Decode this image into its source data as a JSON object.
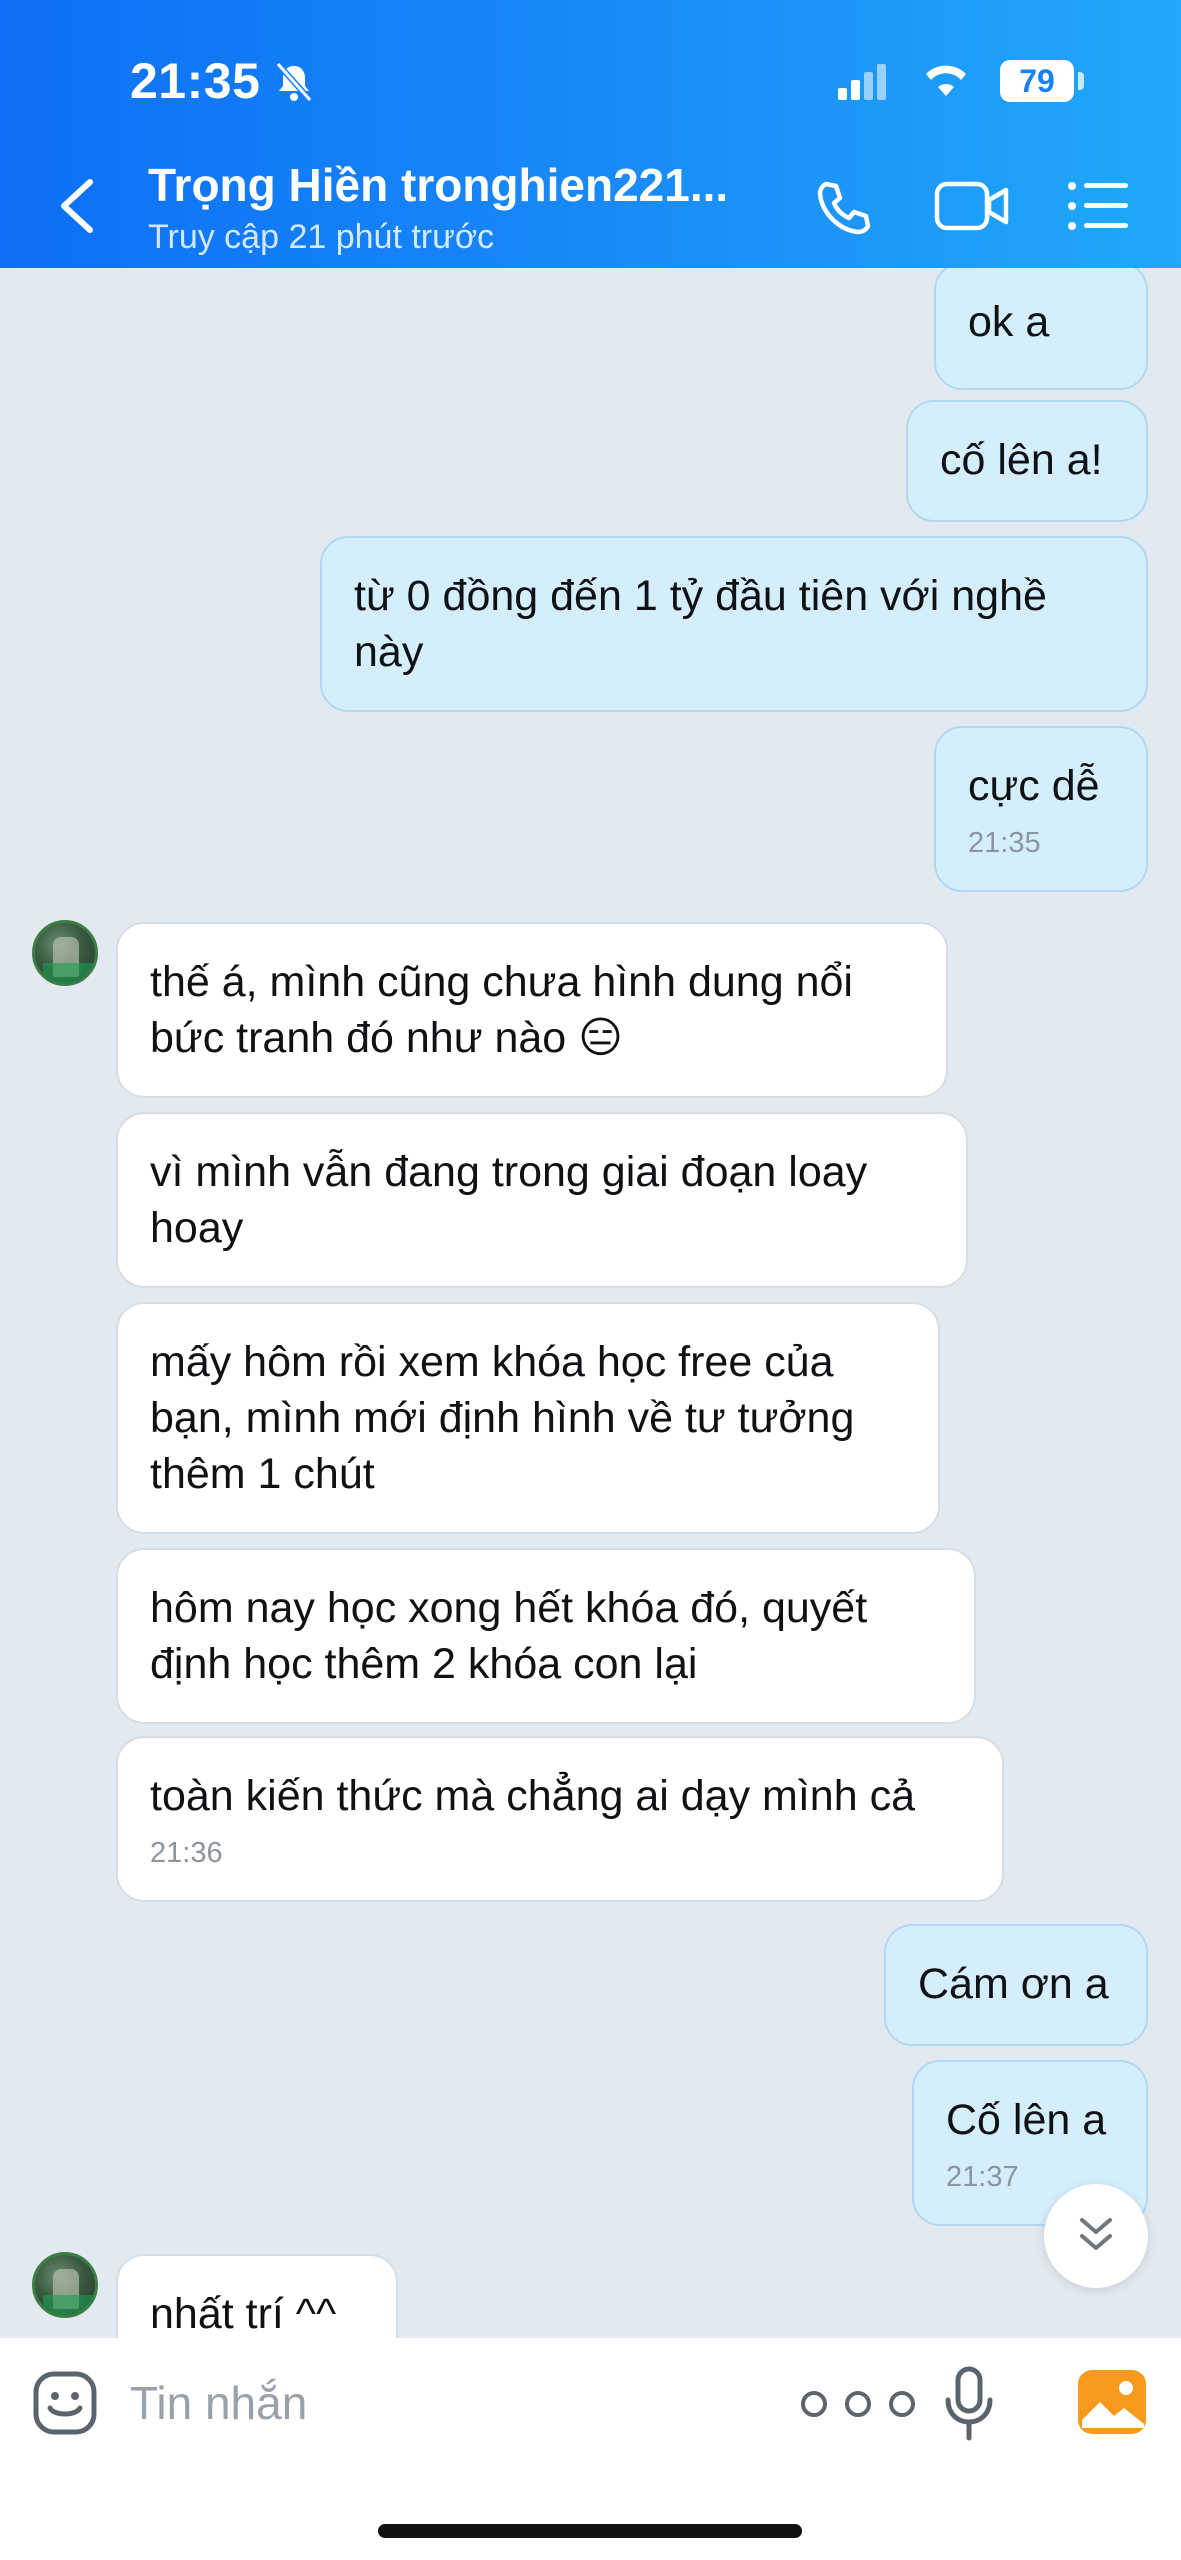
{
  "status_bar": {
    "time": "21:35",
    "battery": "79"
  },
  "header": {
    "contact_name": "Trọng Hiền tronghien221...",
    "contact_status": "Truy cập 21 phút trước"
  },
  "messages": [
    {
      "side": "out",
      "text": "ok a"
    },
    {
      "side": "out",
      "text": "cố lên a!"
    },
    {
      "side": "out",
      "text": "từ 0 đồng đến 1 tỷ đầu tiên với nghề này"
    },
    {
      "side": "out",
      "text": "cực dễ",
      "time": "21:35"
    },
    {
      "side": "in",
      "text": "thế á, mình cũng chưa hình dung nổi bức tranh đó như nào 😑"
    },
    {
      "side": "in",
      "text": "vì mình vẫn đang trong giai đoạn loay hoay"
    },
    {
      "side": "in",
      "text": "mấy hôm rồi xem khóa học free của bạn, mình mới định hình về tư tưởng thêm 1 chút"
    },
    {
      "side": "in",
      "text": "hôm nay học xong hết khóa đó, quyết định học thêm 2 khóa con lại"
    },
    {
      "side": "in",
      "text": "toàn kiến thức mà chẳng ai dạy mình cả",
      "time": "21:36"
    },
    {
      "side": "out",
      "text": "Cám ơn a"
    },
    {
      "side": "out",
      "text": "Cố lên a",
      "time": "21:37"
    },
    {
      "side": "in",
      "text": "nhất trí ^^"
    }
  ],
  "input": {
    "placeholder": "Tin nhắn"
  },
  "colors": {
    "header_start": "#0d6ff5",
    "header_end": "#1fa9f8",
    "chat_bg": "#e2e9f1",
    "outgoing_bubble": "#d4eefc",
    "incoming_bubble": "#ffffff"
  },
  "icons": [
    "back-icon",
    "phone-icon",
    "video-call-icon",
    "menu-list-icon",
    "emoji-icon",
    "more-dots-icon",
    "microphone-icon",
    "image-gallery-icon",
    "chevron-double-down-icon"
  ]
}
